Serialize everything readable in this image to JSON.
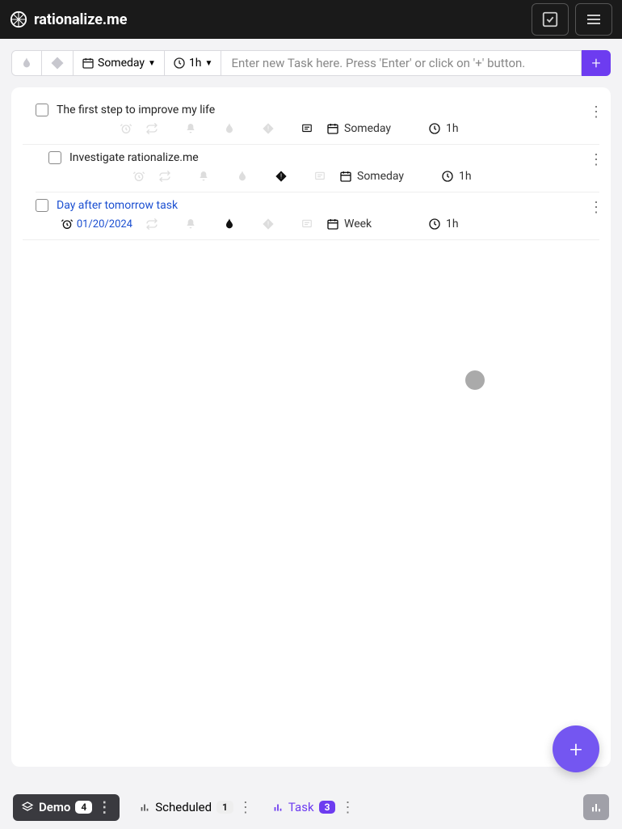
{
  "brand": {
    "name": "rationalize.me"
  },
  "toolbar": {
    "schedule_label": "Someday",
    "duration_label": "1h",
    "input_placeholder": "Enter new Task here. Press 'Enter' or click on '+' button."
  },
  "tasks": [
    {
      "title": "The first step to improve my life",
      "link": false,
      "indented": false,
      "date": "",
      "date_active": false,
      "repeat_active": false,
      "bell_active": false,
      "fire_active": false,
      "priority_active": false,
      "note_active": true,
      "schedule": "Someday",
      "duration": "1h"
    },
    {
      "title": "Investigate rationalize.me",
      "link": false,
      "indented": true,
      "date": "",
      "date_active": false,
      "repeat_active": false,
      "bell_active": false,
      "fire_active": false,
      "priority_active": true,
      "note_active": false,
      "schedule": "Someday",
      "duration": "1h"
    },
    {
      "title": "Day after tomorrow task",
      "link": true,
      "indented": false,
      "date": "01/20/2024",
      "date_active": true,
      "repeat_active": false,
      "bell_active": false,
      "fire_active": true,
      "priority_active": false,
      "note_active": false,
      "schedule": "Week",
      "duration": "1h"
    }
  ],
  "footer": {
    "demo_label": "Demo",
    "demo_count": "4",
    "scheduled_label": "Scheduled",
    "scheduled_count": "1",
    "task_label": "Task",
    "task_count": "3"
  }
}
